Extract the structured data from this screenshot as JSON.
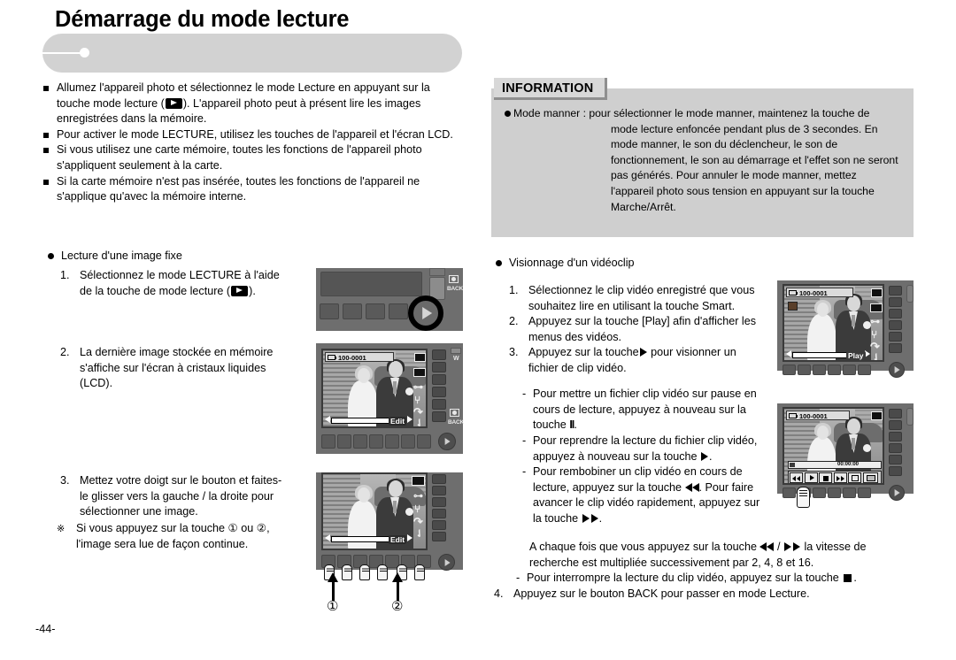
{
  "page": {
    "number": "-44-",
    "title": "Démarrage du mode lecture"
  },
  "left_column": {
    "bullets": [
      {
        "lines": [
          "Allumez l'appareil photo et sélectionnez le mode Lecture en appuyant sur la",
          "touche mode lecture (  ). L'appareil photo peut à présent lire les images",
          "enregistrées dans la mémoire."
        ]
      },
      {
        "lines": [
          "Pour activer le mode LECTURE, utilisez les touches de l'appareil et l'écran LCD."
        ]
      },
      {
        "lines": [
          "Si vous utilisez une carte mémoire, toutes les fonctions de l'appareil photo",
          "s'appliquent seulement à la carte."
        ]
      },
      {
        "lines": [
          "Si la carte mémoire n'est pas insérée, toutes les fonctions de l'appareil ne",
          "s'applique qu'avec la mémoire interne."
        ]
      }
    ],
    "section_heading": "Lecture d'une image fixe",
    "step1": {
      "number": "1.",
      "line1": "Sélectionnez le mode LECTURE à l'aide",
      "line2_pre": "de la touche de mode lecture (",
      "line2_post": ")."
    },
    "step2": {
      "number": "2.",
      "line1": "La dernière image stockée en mémoire",
      "line2": "s'affiche sur l'écran à cristaux liquides",
      "line3": "(LCD)."
    },
    "step3": {
      "number": "3.",
      "line1": "Mettez votre doigt sur le bouton et faites-",
      "line2": "le glisser vers la gauche / la droite pour",
      "line3": "sélectionner une image."
    },
    "note": {
      "symbol": "※",
      "line1": "Si vous appuyez sur la touche ① ou ②,",
      "line2": "l'image sera lue de façon continue."
    }
  },
  "information_box": {
    "tab_label": "INFORMATION",
    "bullet_lead": "Mode manner :",
    "lines": [
      "pour sélectionner le mode manner, maintenez la touche de",
      "mode lecture enfoncée pendant plus de 3 secondes. En",
      "mode manner, le son du déclencheur, le son de",
      "fonctionnement, le son au démarrage et l'effet son ne seront",
      "pas générés. Pour annuler le mode manner, mettez",
      "l'appareil photo sous tension en appuyant sur la touche",
      "Marche/Arrêt."
    ]
  },
  "right_column": {
    "section_heading": "Visionnage d'un vidéoclip",
    "step1": {
      "number": "1.",
      "line1": "Sélectionnez le clip vidéo enregistré que vous",
      "line2": "souhaitez lire en utilisant la touche Smart."
    },
    "step2": {
      "number": "2.",
      "line1": "Appuyez sur la touche [Play] afin d'afficher les",
      "line2": "menus des vidéos."
    },
    "step3": {
      "number": "3.",
      "line1_pre": "Appuyez sur la touche",
      "line1_post": "pour visionner un",
      "line2": "fichier de clip vidéo."
    },
    "dash1": {
      "line1": "Pour mettre un fichier clip vidéo sur pause en",
      "line2": "cours de lecture, appuyez à nouveau sur la",
      "line3_pre": "touche",
      "line3_glyph": "II",
      "line3_post": "."
    },
    "dash2": {
      "line1": "Pour reprendre la lecture du fichier clip vidéo,",
      "line2_pre": "appuyez à nouveau sur la touche",
      "line2_post": "."
    },
    "dash3": {
      "line1": "Pour rembobiner un clip vidéo en cours de",
      "line2_pre": "lecture, appuyez sur la touche",
      "line2_post": ". Pour faire",
      "line3": "avancer le clip vidéo rapidement, appuyez sur",
      "line4_pre": "la touche",
      "line4_post": "."
    },
    "para": {
      "line1_pre": "A chaque fois que vous appuyez sur la touche",
      "line1_mid": "/",
      "line1_post": "la vitesse de",
      "line2": "recherche est multipliée successivement par 2, 4, 8 et 16."
    },
    "dash4": {
      "line_pre": "Pour interrompre la lecture du clip vidéo, appuyez sur la touche",
      "line_post": "."
    },
    "step4": {
      "number": "4.",
      "line1": "Appuyez sur le bouton BACK pour passer en mode Lecture."
    }
  },
  "illustrations": {
    "camera_top_left": {
      "back_label": "BACK",
      "icon": "play-button-highlight"
    },
    "camera_mid_left": {
      "file_label": "100-0001",
      "edit_label": "Edit",
      "back_label": "BACK",
      "zoom_label": "W"
    },
    "camera_bottom_left": {
      "edit_label": "Edit",
      "marker1": "①",
      "marker2": "②"
    },
    "camera_top_right": {
      "file_label": "100-0001",
      "play_label": "Play"
    },
    "camera_bottom_right": {
      "file_label": "100-0001",
      "time_label": "00:00:00"
    }
  },
  "colors": {
    "header_bg": "#d2d2d2",
    "info_bg": "#cfcfcf",
    "info_tab_bg": "#d8d8d8",
    "camera_body": "#6e6e6e",
    "text": "#000000"
  }
}
